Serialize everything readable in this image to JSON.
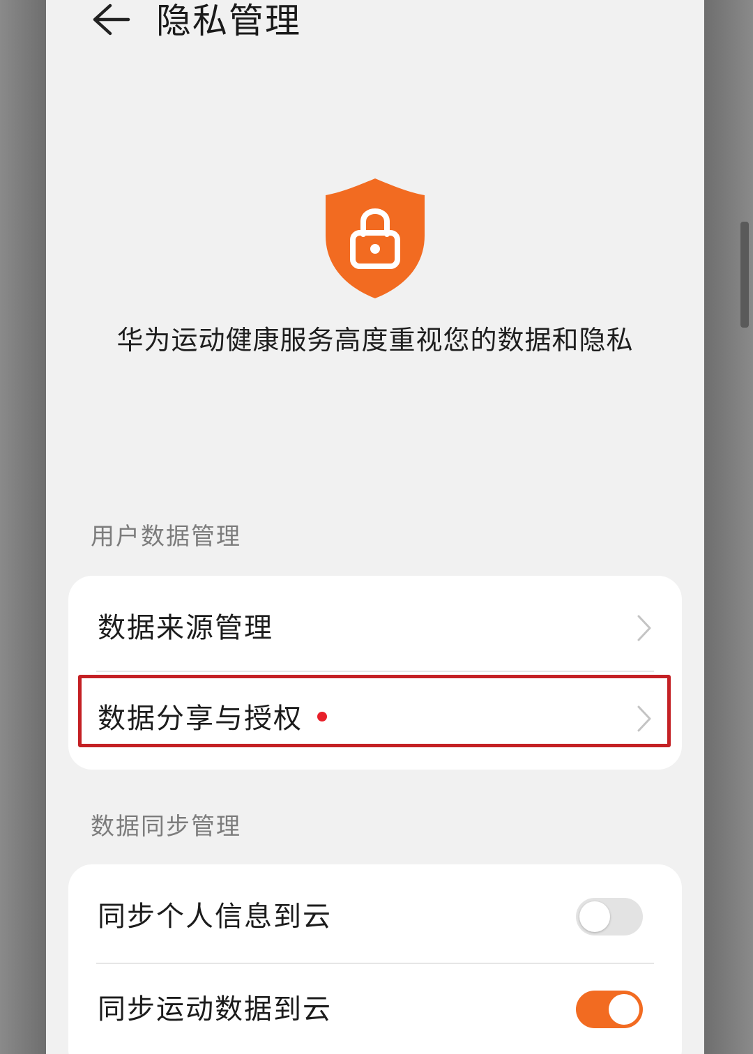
{
  "header": {
    "title": "隐私管理"
  },
  "hero": {
    "icon": "shield-lock-icon",
    "text": "华为运动健康服务高度重视您的数据和隐私"
  },
  "sections": {
    "user_data": {
      "title": "用户数据管理",
      "items": [
        {
          "label": "数据来源管理"
        },
        {
          "label": "数据分享与授权",
          "has_new_badge": true
        }
      ]
    },
    "data_sync": {
      "title": "数据同步管理",
      "items": [
        {
          "label": "同步个人信息到云",
          "toggle_on": false
        },
        {
          "label": "同步运动数据到云",
          "toggle_on": true
        }
      ]
    }
  },
  "colors": {
    "accent": "#f26b21",
    "badge": "#e8202a",
    "highlight_box": "#c42024"
  }
}
